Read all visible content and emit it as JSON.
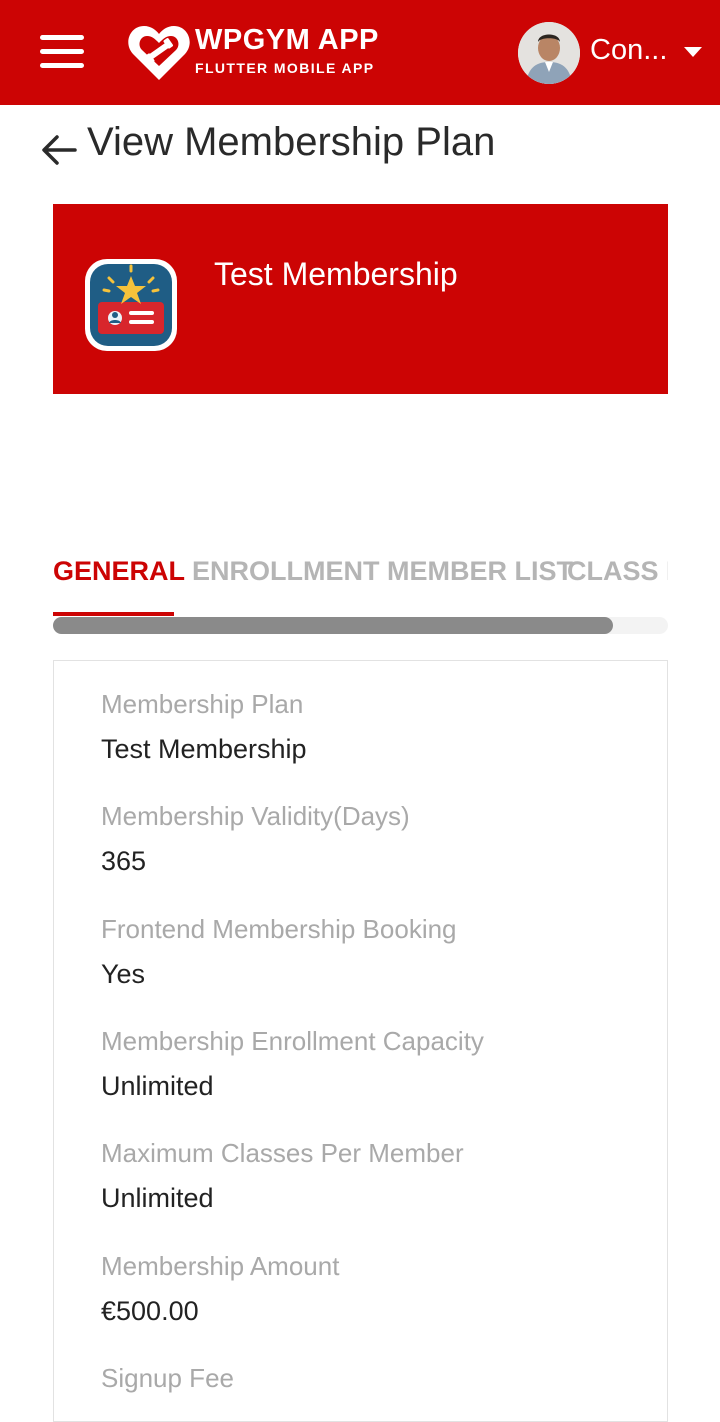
{
  "app": {
    "brand_title": "WPGYM APP",
    "brand_subtitle": "FLUTTER MOBILE APP",
    "user_name": "Con...",
    "accent_color": "#cc0404"
  },
  "page": {
    "title": "View Membership Plan"
  },
  "banner": {
    "plan_name": "Test Membership"
  },
  "tabs": [
    {
      "label": "GENERAL",
      "active": true
    },
    {
      "label": "ENROLLMENT MEMBER LIST",
      "active": false
    },
    {
      "label": "CLASS L",
      "active": false
    }
  ],
  "tab_scroll_fraction": 0.91,
  "details": [
    {
      "label": "Membership Plan",
      "value": "Test Membership"
    },
    {
      "label": "Membership Validity(Days)",
      "value": "365"
    },
    {
      "label": "Frontend Membership Booking",
      "value": "Yes"
    },
    {
      "label": "Membership Enrollment Capacity",
      "value": "Unlimited"
    },
    {
      "label": "Maximum Classes Per Member",
      "value": "Unlimited"
    },
    {
      "label": "Membership Amount",
      "value": "€500.00"
    },
    {
      "label": "Signup Fee",
      "value": ""
    }
  ]
}
